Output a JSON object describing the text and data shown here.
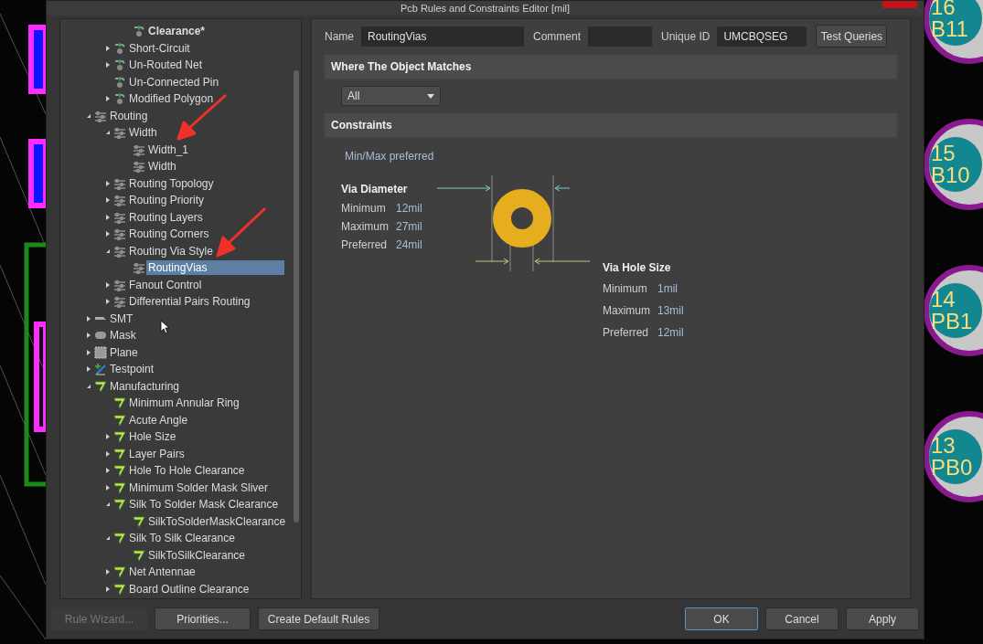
{
  "window": {
    "title": "Pcb Rules and Constraints Editor [mil]"
  },
  "tree": [
    {
      "children": [
        {
          "children": [
            {
              "label": "Clearance*",
              "kind": "clearance",
              "selected": false,
              "modified": true
            }
          ]
        },
        {
          "label": "Short-Circuit",
          "kind": "clearance",
          "expanded": false,
          "selected": false,
          "modified": false
        },
        {
          "label": "Un-Routed Net",
          "kind": "clearance",
          "expanded": false,
          "selected": false,
          "modified": false
        },
        {
          "label": "Un-Connected Pin",
          "kind": "clearance",
          "selected": false,
          "modified": false
        },
        {
          "label": "Modified Polygon",
          "kind": "clearance",
          "expanded": false,
          "selected": false,
          "modified": false
        }
      ]
    },
    {
      "label": "Routing",
      "kind": "routing",
      "expanded": true,
      "selected": false,
      "modified": false,
      "children": [
        {
          "label": "Width",
          "kind": "routing",
          "expanded": true,
          "selected": false,
          "modified": false,
          "children": [
            {
              "label": "Width_1",
              "kind": "routing",
              "selected": false,
              "modified": false
            },
            {
              "label": "Width",
              "kind": "routing",
              "selected": false,
              "modified": false
            }
          ]
        },
        {
          "label": "Routing Topology",
          "kind": "routing",
          "expanded": false,
          "selected": false,
          "modified": false
        },
        {
          "label": "Routing Priority",
          "kind": "routing",
          "expanded": false,
          "selected": false,
          "modified": false
        },
        {
          "label": "Routing Layers",
          "kind": "routing",
          "expanded": false,
          "selected": false,
          "modified": false
        },
        {
          "label": "Routing Corners",
          "kind": "routing",
          "expanded": false,
          "selected": false,
          "modified": false
        },
        {
          "label": "Routing Via Style",
          "kind": "routing",
          "expanded": true,
          "selected": false,
          "modified": false,
          "children": [
            {
              "label": "RoutingVias",
              "kind": "routing",
              "selected": true,
              "modified": false
            }
          ]
        },
        {
          "label": "Fanout Control",
          "kind": "routing",
          "expanded": false,
          "selected": false,
          "modified": false
        },
        {
          "label": "Differential Pairs Routing",
          "kind": "routing",
          "expanded": false,
          "selected": false,
          "modified": false
        }
      ]
    },
    {
      "label": "SMT",
      "kind": "smt",
      "expanded": false,
      "selected": false,
      "modified": false
    },
    {
      "label": "Mask",
      "kind": "mask",
      "expanded": false,
      "selected": false,
      "modified": false
    },
    {
      "label": "Plane",
      "kind": "plane",
      "expanded": false,
      "selected": false,
      "modified": false
    },
    {
      "label": "Testpoint",
      "kind": "testpoint",
      "expanded": false,
      "selected": false,
      "modified": false
    },
    {
      "label": "Manufacturing",
      "kind": "manufacturing",
      "expanded": true,
      "selected": false,
      "modified": false,
      "children": [
        {
          "label": "Minimum Annular Ring",
          "kind": "manufacturing",
          "selected": false,
          "modified": false
        },
        {
          "label": "Acute Angle",
          "kind": "manufacturing",
          "selected": false,
          "modified": false
        },
        {
          "label": "Hole Size",
          "kind": "manufacturing",
          "expanded": false,
          "selected": false,
          "modified": false
        },
        {
          "label": "Layer Pairs",
          "kind": "manufacturing",
          "expanded": false,
          "selected": false,
          "modified": false
        },
        {
          "label": "Hole To Hole Clearance",
          "kind": "manufacturing",
          "expanded": false,
          "selected": false,
          "modified": false
        },
        {
          "label": "Minimum Solder Mask Sliver",
          "kind": "manufacturing",
          "expanded": false,
          "selected": false,
          "modified": false
        },
        {
          "label": "Silk To Solder Mask Clearance",
          "kind": "manufacturing",
          "expanded": true,
          "selected": false,
          "modified": false,
          "children": [
            {
              "label": "SilkToSolderMaskClearance",
              "kind": "manufacturing",
              "selected": false,
              "modified": false
            }
          ]
        },
        {
          "label": "Silk To Silk Clearance",
          "kind": "manufacturing",
          "expanded": true,
          "selected": false,
          "modified": false,
          "children": [
            {
              "label": "SilkToSilkClearance",
              "kind": "manufacturing",
              "selected": false,
              "modified": false
            }
          ]
        },
        {
          "label": "Net Antennae",
          "kind": "manufacturing",
          "expanded": false,
          "selected": false,
          "modified": false
        },
        {
          "label": "Board Outline Clearance",
          "kind": "manufacturing",
          "expanded": false,
          "selected": false,
          "modified": false
        }
      ]
    }
  ],
  "rule": {
    "name_label": "Name",
    "name": "RoutingVias",
    "comment_label": "Comment",
    "unique_id_label": "Unique ID",
    "unique_id": "UMCBQSEG",
    "test_button": "Test Queries"
  },
  "match_section": {
    "title": "Where The Object Matches",
    "scope": "All"
  },
  "constraints": {
    "title": "Constraints",
    "mode": "Min/Max preferred",
    "via_diameter": {
      "title": "Via Diameter",
      "rows": [
        {
          "label": "Minimum",
          "value": "12mil"
        },
        {
          "label": "Maximum",
          "value": "27mil"
        },
        {
          "label": "Preferred",
          "value": "24mil"
        }
      ]
    },
    "via_hole_size": {
      "title": "Via Hole Size",
      "rows": [
        {
          "label": "Minimum",
          "value": "1mil"
        },
        {
          "label": "Maximum",
          "value": "13mil"
        },
        {
          "label": "Preferred",
          "value": "12mil"
        }
      ]
    }
  },
  "buttons": [
    {
      "label": "Rule Wizard...",
      "disabled": true,
      "default": false
    },
    {
      "label": "Priorities...",
      "disabled": false,
      "default": false
    },
    {
      "label": "Create Default Rules",
      "disabled": false,
      "default": false
    },
    {
      "label": "OK",
      "disabled": false,
      "default": true
    },
    {
      "label": "Cancel",
      "disabled": false,
      "default": false
    },
    {
      "label": "Apply",
      "disabled": false,
      "default": false
    }
  ],
  "pcb_pads": [
    {
      "number": "16",
      "name": "B11"
    },
    {
      "number": "15",
      "name": "B10"
    },
    {
      "number": "14",
      "name": "PB1"
    },
    {
      "number": "13",
      "name": "PB0"
    }
  ]
}
